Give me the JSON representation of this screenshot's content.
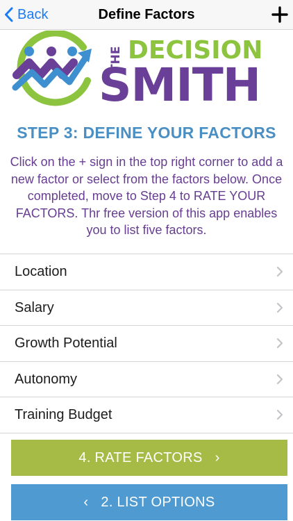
{
  "nav": {
    "back_label": "Back",
    "title": "Define Factors",
    "add_icon": "plus-icon"
  },
  "logo": {
    "the": "THE",
    "decision": "DECISION",
    "smith": "SMITH",
    "colors": {
      "green": "#8dc43f",
      "purple": "#6a3f97",
      "blue": "#3d8fd0"
    }
  },
  "step": {
    "title": "STEP 3: DEFINE YOUR FACTORS",
    "description": "Click on the + sign in the top right corner to add a new factor or select from the factors below. Once completed, move to Step 4 to RATE YOUR FACTORS. Thr free version of this app enables you to list five factors."
  },
  "factors": [
    {
      "label": "Location"
    },
    {
      "label": "Salary"
    },
    {
      "label": "Growth Potential"
    },
    {
      "label": "Autonomy"
    },
    {
      "label": "Training Budget"
    }
  ],
  "buttons": {
    "rate": {
      "label": "4. RATE FACTORS",
      "glyph": "›",
      "color": "#a5bb45"
    },
    "list": {
      "label": "2. LIST OPTIONS",
      "glyph": "‹",
      "color": "#4f9ad0"
    }
  }
}
